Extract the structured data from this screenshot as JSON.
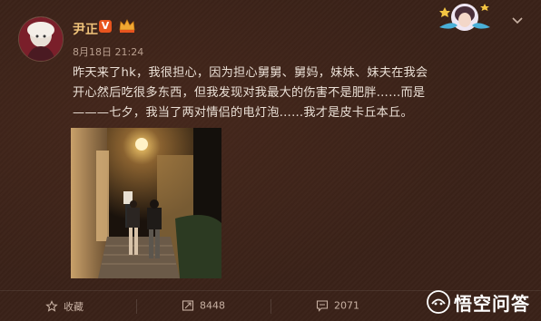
{
  "post": {
    "user": {
      "name": "尹正",
      "verified_mark": "V",
      "crown_icon": "crown-icon"
    },
    "time": "8月18日 21:24",
    "text": "昨天来了hk，我很担心，因为担心舅舅、舅妈，妹妹、妹夫在我会开心然后吃很多东西，但我发现对我最大的伤害不是肥胖……而是———七夕，我当了两对情侣的电灯泡……我才是皮卡丘本丘。"
  },
  "actions": {
    "favorite_label": "收藏",
    "forward_count": "8448",
    "comment_count": "2071"
  },
  "watermark": {
    "text": "悟空问答"
  },
  "colors": {
    "background": "#3a2218",
    "username": "#f0c37a",
    "verified": "#e8541e",
    "text": "#eadfd5",
    "muted": "#b99f8f"
  }
}
